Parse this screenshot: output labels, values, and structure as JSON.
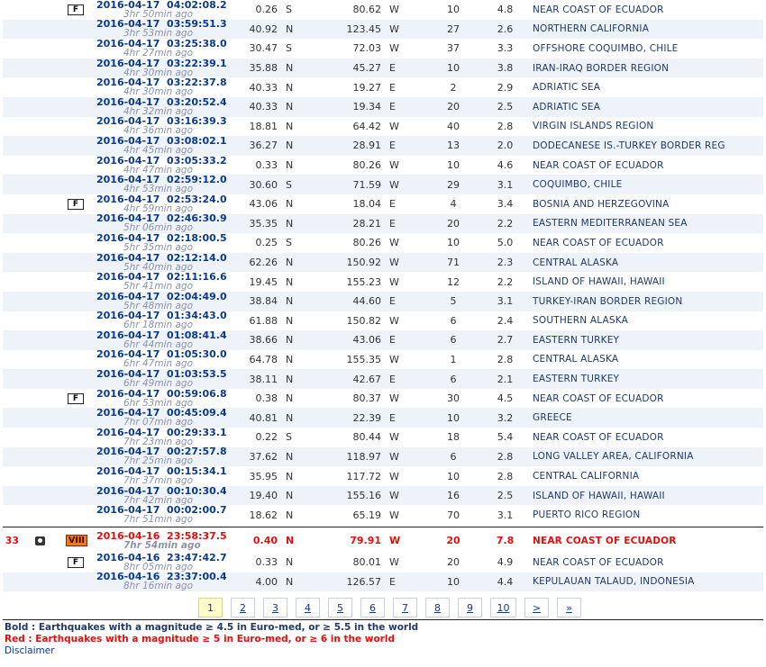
{
  "rows_main": [
    {
      "f": true,
      "date": "2016-04-17",
      "time": "04:02:08.2",
      "ago": "3hr 50min ago",
      "lat": "0.26",
      "ns": "S",
      "lon": "80.62",
      "ew": "W",
      "depth": "10",
      "mag": "4.8",
      "region": "NEAR COAST OF ECUADOR"
    },
    {
      "date": "2016-04-17",
      "time": "03:59:51.3",
      "ago": "3hr 53min ago",
      "lat": "40.92",
      "ns": "N",
      "lon": "123.45",
      "ew": "W",
      "depth": "27",
      "mag": "2.6",
      "region": "NORTHERN CALIFORNIA"
    },
    {
      "date": "2016-04-17",
      "time": "03:25:38.0",
      "ago": "4hr 27min ago",
      "lat": "30.47",
      "ns": "S",
      "lon": "72.03",
      "ew": "W",
      "depth": "37",
      "mag": "3.3",
      "region": "OFFSHORE COQUIMBO, CHILE"
    },
    {
      "date": "2016-04-17",
      "time": "03:22:39.1",
      "ago": "4hr 30min ago",
      "lat": "35.88",
      "ns": "N",
      "lon": "45.27",
      "ew": "E",
      "depth": "10",
      "mag": "3.8",
      "region": "IRAN-IRAQ BORDER REGION"
    },
    {
      "date": "2016-04-17",
      "time": "03:22:37.8",
      "ago": "4hr 30min ago",
      "lat": "40.33",
      "ns": "N",
      "lon": "19.27",
      "ew": "E",
      "depth": "2",
      "mag": "2.9",
      "region": "ADRIATIC SEA"
    },
    {
      "date": "2016-04-17",
      "time": "03:20:52.4",
      "ago": "4hr 32min ago",
      "lat": "40.33",
      "ns": "N",
      "lon": "19.34",
      "ew": "E",
      "depth": "20",
      "mag": "2.5",
      "region": "ADRIATIC SEA"
    },
    {
      "date": "2016-04-17",
      "time": "03:16:39.3",
      "ago": "4hr 36min ago",
      "lat": "18.81",
      "ns": "N",
      "lon": "64.42",
      "ew": "W",
      "depth": "40",
      "mag": "2.8",
      "region": "VIRGIN ISLANDS REGION"
    },
    {
      "date": "2016-04-17",
      "time": "03:08:02.1",
      "ago": "4hr 45min ago",
      "lat": "36.27",
      "ns": "N",
      "lon": "28.91",
      "ew": "E",
      "depth": "13",
      "mag": "2.0",
      "region": "DODECANESE IS.-TURKEY BORDER REG"
    },
    {
      "date": "2016-04-17",
      "time": "03:05:33.2",
      "ago": "4hr 47min ago",
      "lat": "0.33",
      "ns": "N",
      "lon": "80.26",
      "ew": "W",
      "depth": "10",
      "mag": "4.6",
      "region": "NEAR COAST OF ECUADOR"
    },
    {
      "date": "2016-04-17",
      "time": "02:59:12.0",
      "ago": "4hr 53min ago",
      "lat": "30.60",
      "ns": "S",
      "lon": "71.59",
      "ew": "W",
      "depth": "29",
      "mag": "3.1",
      "region": "COQUIMBO, CHILE"
    },
    {
      "f": true,
      "date": "2016-04-17",
      "time": "02:53:24.0",
      "ago": "4hr 59min ago",
      "lat": "43.06",
      "ns": "N",
      "lon": "18.04",
      "ew": "E",
      "depth": "4",
      "mag": "3.4",
      "region": "BOSNIA AND HERZEGOVINA"
    },
    {
      "date": "2016-04-17",
      "time": "02:46:30.9",
      "ago": "5hr 06min ago",
      "lat": "35.35",
      "ns": "N",
      "lon": "28.21",
      "ew": "E",
      "depth": "20",
      "mag": "2.2",
      "region": "EASTERN MEDITERRANEAN SEA"
    },
    {
      "date": "2016-04-17",
      "time": "02:18:00.5",
      "ago": "5hr 35min ago",
      "lat": "0.25",
      "ns": "S",
      "lon": "80.26",
      "ew": "W",
      "depth": "10",
      "mag": "5.0",
      "region": "NEAR COAST OF ECUADOR"
    },
    {
      "date": "2016-04-17",
      "time": "02:12:14.0",
      "ago": "5hr 40min ago",
      "lat": "62.26",
      "ns": "N",
      "lon": "150.92",
      "ew": "W",
      "depth": "71",
      "mag": "2.3",
      "region": "CENTRAL ALASKA"
    },
    {
      "date": "2016-04-17",
      "time": "02:11:16.6",
      "ago": "5hr 41min ago",
      "lat": "19.45",
      "ns": "N",
      "lon": "155.23",
      "ew": "W",
      "depth": "12",
      "mag": "2.2",
      "region": "ISLAND OF HAWAII, HAWAII"
    },
    {
      "date": "2016-04-17",
      "time": "02:04:49.0",
      "ago": "5hr 48min ago",
      "lat": "38.84",
      "ns": "N",
      "lon": "44.60",
      "ew": "E",
      "depth": "5",
      "mag": "3.1",
      "region": "TURKEY-IRAN BORDER REGION"
    },
    {
      "date": "2016-04-17",
      "time": "01:34:43.0",
      "ago": "6hr 18min ago",
      "lat": "61.88",
      "ns": "N",
      "lon": "150.82",
      "ew": "W",
      "depth": "6",
      "mag": "2.4",
      "region": "SOUTHERN ALASKA"
    },
    {
      "date": "2016-04-17",
      "time": "01:08:41.4",
      "ago": "6hr 44min ago",
      "lat": "38.66",
      "ns": "N",
      "lon": "43.06",
      "ew": "E",
      "depth": "6",
      "mag": "2.7",
      "region": "EASTERN TURKEY"
    },
    {
      "date": "2016-04-17",
      "time": "01:05:30.0",
      "ago": "6hr 47min ago",
      "lat": "64.78",
      "ns": "N",
      "lon": "155.35",
      "ew": "W",
      "depth": "1",
      "mag": "2.8",
      "region": "CENTRAL ALASKA"
    },
    {
      "date": "2016-04-17",
      "time": "01:03:53.5",
      "ago": "6hr 49min ago",
      "lat": "38.11",
      "ns": "N",
      "lon": "42.67",
      "ew": "E",
      "depth": "6",
      "mag": "2.1",
      "region": "EASTERN TURKEY"
    },
    {
      "f": true,
      "date": "2016-04-17",
      "time": "00:59:06.8",
      "ago": "6hr 53min ago",
      "lat": "0.38",
      "ns": "N",
      "lon": "80.37",
      "ew": "W",
      "depth": "30",
      "mag": "4.5",
      "region": "NEAR COAST OF ECUADOR"
    },
    {
      "date": "2016-04-17",
      "time": "00:45:09.4",
      "ago": "7hr 07min ago",
      "lat": "40.81",
      "ns": "N",
      "lon": "22.39",
      "ew": "E",
      "depth": "10",
      "mag": "3.2",
      "region": "GREECE"
    },
    {
      "date": "2016-04-17",
      "time": "00:29:33.1",
      "ago": "7hr 23min ago",
      "lat": "0.22",
      "ns": "S",
      "lon": "80.44",
      "ew": "W",
      "depth": "18",
      "mag": "5.4",
      "region": "NEAR COAST OF ECUADOR"
    },
    {
      "date": "2016-04-17",
      "time": "00:27:57.8",
      "ago": "7hr 25min ago",
      "lat": "37.62",
      "ns": "N",
      "lon": "118.97",
      "ew": "W",
      "depth": "6",
      "mag": "2.8",
      "region": "LONG VALLEY AREA, CALIFORNIA"
    },
    {
      "date": "2016-04-17",
      "time": "00:15:34.1",
      "ago": "7hr 37min ago",
      "lat": "35.95",
      "ns": "N",
      "lon": "117.72",
      "ew": "W",
      "depth": "10",
      "mag": "2.8",
      "region": "CENTRAL CALIFORNIA"
    },
    {
      "date": "2016-04-17",
      "time": "00:10:30.4",
      "ago": "7hr 42min ago",
      "lat": "19.40",
      "ns": "N",
      "lon": "155.16",
      "ew": "W",
      "depth": "16",
      "mag": "2.5",
      "region": "ISLAND OF HAWAII, HAWAII"
    },
    {
      "date": "2016-04-17",
      "time": "00:02:00.7",
      "ago": "7hr 51min ago",
      "lat": "18.62",
      "ns": "N",
      "lon": "65.19",
      "ew": "W",
      "depth": "70",
      "mag": "3.1",
      "region": "PUERTO RICO REGION"
    }
  ],
  "row_big": {
    "num": "33",
    "intensity": "VIII",
    "date": "2016-04-16",
    "time": "23:58:37.5",
    "ago": "7hr 54min ago",
    "lat": "0.40",
    "ns": "N",
    "lon": "79.91",
    "ew": "W",
    "depth": "20",
    "mag": "7.8",
    "region": "NEAR COAST OF ECUADOR"
  },
  "rows_tail": [
    {
      "f": true,
      "date": "2016-04-16",
      "time": "23:47:42.7",
      "ago": "8hr 05min ago",
      "lat": "0.33",
      "ns": "N",
      "lon": "80.01",
      "ew": "W",
      "depth": "20",
      "mag": "4.9",
      "region": "NEAR COAST OF ECUADOR"
    },
    {
      "date": "2016-04-16",
      "time": "23:37:00.4",
      "ago": "8hr 16min ago",
      "lat": "4.00",
      "ns": "N",
      "lon": "126.57",
      "ew": "E",
      "depth": "10",
      "mag": "4.4",
      "region": "KEPULAUAN TALAUD, INDONESIA"
    }
  ],
  "f_label": "F",
  "pager": {
    "pages": [
      "1",
      "2",
      "3",
      "4",
      "5",
      "6",
      "7",
      "8",
      "9",
      "10"
    ],
    "current": "1",
    "next": ">",
    "last": "»"
  },
  "legend_bold": "Bold : Earthquakes with a magnitude ≥ 4.5 in Euro-med, or ≥ 5.5 in the world",
  "legend_red": "Red : Earthquakes with a magnitude ≥ 5 in Euro-med, or ≥ 6 in the world",
  "disclaimer": "Disclaimer",
  "colors": {
    "red": "#e01010",
    "link": "#0b3a8c",
    "row_alt": "#eef2f9",
    "intensity": "#f07a15"
  }
}
